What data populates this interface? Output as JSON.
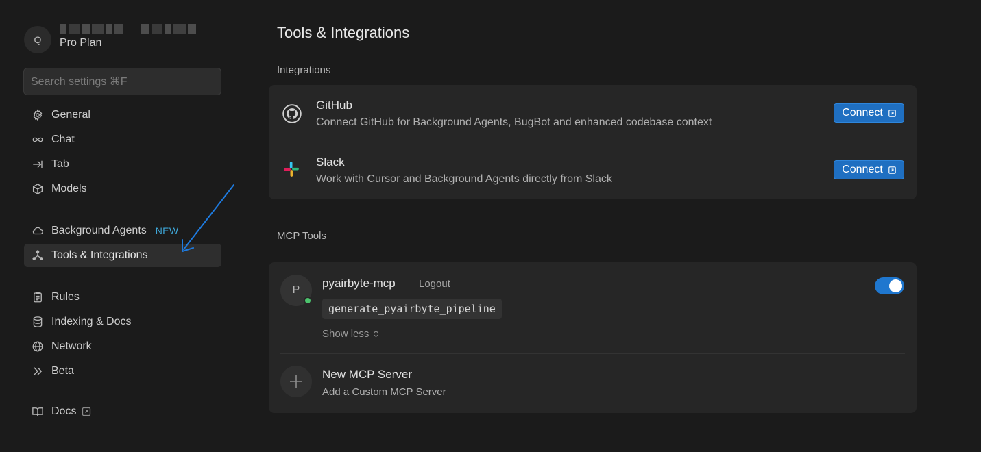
{
  "sidebar": {
    "avatar_letter": "Q",
    "plan": "Pro Plan",
    "search_placeholder": "Search settings ⌘F",
    "items": [
      {
        "label": "General",
        "icon": "gear-icon"
      },
      {
        "label": "Chat",
        "icon": "infinity-icon"
      },
      {
        "label": "Tab",
        "icon": "tab-arrow-icon"
      },
      {
        "label": "Models",
        "icon": "cube-icon"
      },
      {
        "label": "Background Agents",
        "icon": "cloud-icon",
        "badge": "NEW"
      },
      {
        "label": "Tools & Integrations",
        "icon": "nodes-icon",
        "active": true
      },
      {
        "label": "Rules",
        "icon": "clipboard-icon"
      },
      {
        "label": "Indexing & Docs",
        "icon": "database-icon"
      },
      {
        "label": "Network",
        "icon": "globe-icon"
      },
      {
        "label": "Beta",
        "icon": "chevrons-right-icon"
      },
      {
        "label": "Docs",
        "icon": "book-icon"
      }
    ]
  },
  "main": {
    "title": "Tools & Integrations",
    "integrations": {
      "heading": "Integrations",
      "items": [
        {
          "name": "GitHub",
          "description": "Connect GitHub for Background Agents, BugBot and enhanced codebase context",
          "button": "Connect"
        },
        {
          "name": "Slack",
          "description": "Work with Cursor and Background Agents directly from Slack",
          "button": "Connect"
        }
      ]
    },
    "mcp": {
      "heading": "MCP Tools",
      "server": {
        "avatar_letter": "P",
        "name": "pyairbyte-mcp",
        "logout": "Logout",
        "tool": "generate_pyairbyte_pipeline",
        "show_less": "Show less",
        "enabled": true
      },
      "new_server": {
        "title": "New MCP Server",
        "subtitle": "Add a Custom MCP Server"
      }
    }
  },
  "colors": {
    "background": "#1b1b1b",
    "card": "#262626",
    "accent": "#1f6fc1",
    "badge": "#3ea7d8",
    "status_online": "#4cc36d",
    "annotation_arrow": "#1e7be0"
  }
}
